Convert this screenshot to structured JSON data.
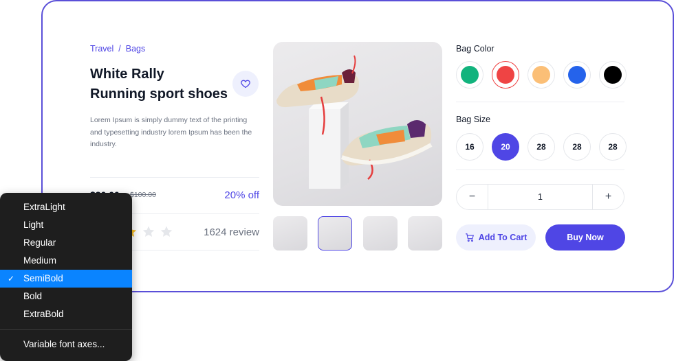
{
  "breadcrumb": {
    "parent": "Travel",
    "separator": "/",
    "current": "Bags"
  },
  "product": {
    "title_line1": "White Rally",
    "title_line2": "Running sport shoes",
    "description": "Lorem Ipsum is simply dummy text of the printing and typesetting industry lorem Ipsum has been the industry.",
    "price_current": "$80.00",
    "price_old": "$100.00",
    "discount": "20% off",
    "rating": 3,
    "rating_max": 5,
    "reviews": "1624 review"
  },
  "colors": {
    "label": "Bag Color",
    "options": [
      "#12b37d",
      "#ef4444",
      "#fbbf77",
      "#2563eb",
      "#000000"
    ],
    "selected_index": 1
  },
  "sizes": {
    "label": "Bag Size",
    "options": [
      "16",
      "20",
      "28",
      "28",
      "28"
    ],
    "selected_index": 1
  },
  "quantity": {
    "minus": "−",
    "value": "1",
    "plus": "+"
  },
  "actions": {
    "add_to_cart": "Add To Cart",
    "buy_now": "Buy Now"
  },
  "thumbnails": {
    "count": 4,
    "selected_index": 1
  },
  "font_menu": {
    "items": [
      "ExtraLight",
      "Light",
      "Regular",
      "Medium",
      "SemiBold",
      "Bold",
      "ExtraBold"
    ],
    "selected": "SemiBold",
    "check": "✓",
    "footer": "Variable font axes..."
  },
  "theme": {
    "accent": "#4f46e5",
    "menu_bg": "#1e1e1e",
    "menu_highlight": "#0a84ff",
    "star": "#fbbf24"
  }
}
